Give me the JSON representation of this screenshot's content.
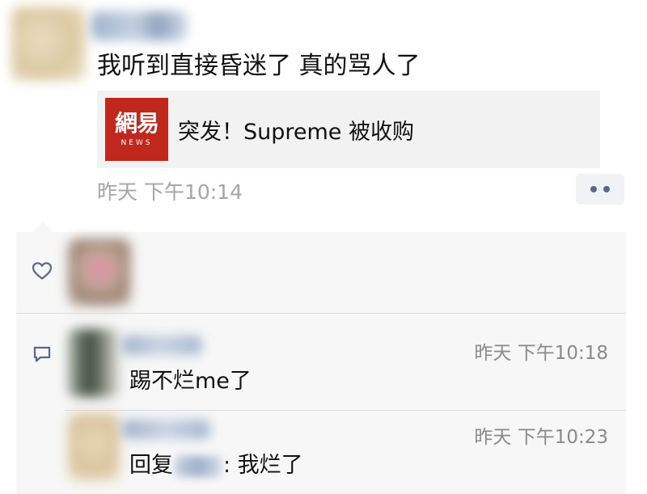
{
  "post": {
    "text": "我听到直接昏迷了 真的骂人了",
    "link_card": {
      "logo_cn": "網易",
      "logo_en": "NEWS",
      "title": "突发！Supreme 被收购"
    },
    "time": "昨天 下午10:14"
  },
  "comments": [
    {
      "time": "昨天 下午10:18",
      "text": "踢不烂me了"
    },
    {
      "time": "昨天 下午10:23",
      "reply_prefix": "回复",
      "text": ": 我烂了"
    }
  ],
  "colors": {
    "logo_red": "#c0281e",
    "link_blue": "#57698a",
    "time_grey": "#a5a5a5",
    "panel_bg": "#f7f7f7"
  }
}
